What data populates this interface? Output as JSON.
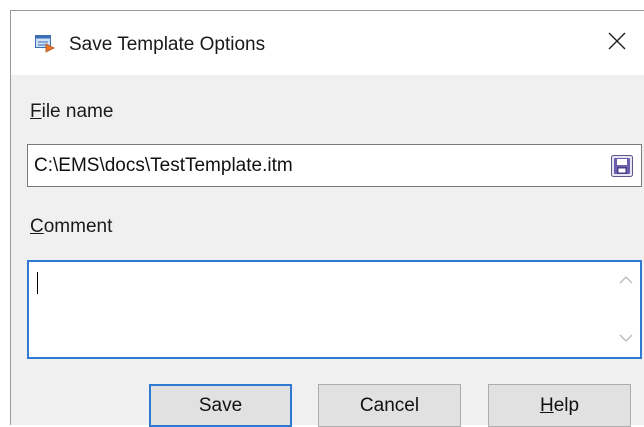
{
  "dialog": {
    "title": "Save Template Options",
    "close_glyph": "✕"
  },
  "file_name": {
    "label_first": "F",
    "label_rest": "ile name",
    "value": "C:\\EMS\\docs\\TestTemplate.itm",
    "browse_icon": "floppy-disk-icon"
  },
  "comment": {
    "label_first": "C",
    "label_rest": "omment",
    "value": ""
  },
  "buttons": {
    "save": "Save",
    "cancel": "Cancel",
    "help_first": "H",
    "help_rest": "elp"
  },
  "colors": {
    "focus_blue": "#2f7ad0",
    "dialog_bg": "#f0f0f0"
  }
}
